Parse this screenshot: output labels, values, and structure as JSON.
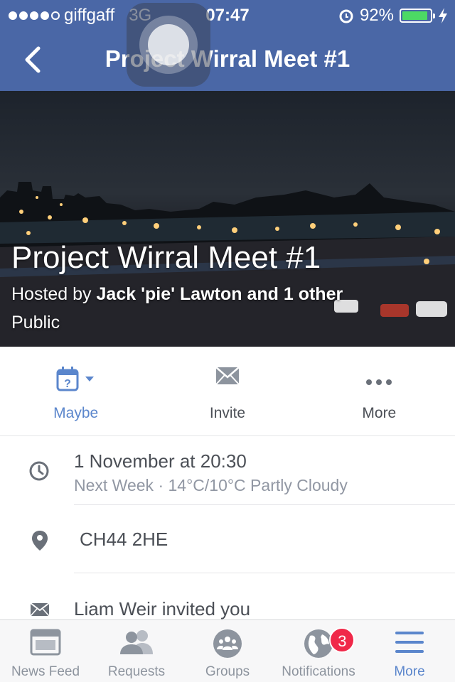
{
  "status_bar": {
    "carrier": "giffgaff",
    "network": "3G",
    "time": "07:47",
    "battery": "92%",
    "battery_level": 0.92,
    "signal_bars": 4
  },
  "nav": {
    "title": "Project Wirral Meet #1"
  },
  "event": {
    "title": "Project Wirral Meet #1",
    "hosted_prefix": "Hosted by ",
    "hosts": "Jack 'pie' Lawton and 1 other",
    "privacy": "Public"
  },
  "actions": {
    "maybe": "Maybe",
    "invite": "Invite",
    "more": "More"
  },
  "details": {
    "date": "1 November at 20:30",
    "date_sub": "Next Week · 14°C/10°C Partly Cloudy",
    "location": "CH44 2HE",
    "invite_text": "Liam Weir invited you"
  },
  "tabs": {
    "news_feed": "News Feed",
    "requests": "Requests",
    "groups": "Groups",
    "notifications": "Notifications",
    "notifications_badge": "3",
    "more": "More"
  },
  "colors": {
    "nav_bar": "#4a67a6",
    "accent": "#5b86cc",
    "badge": "#f02849",
    "battery": "#4cd964"
  }
}
